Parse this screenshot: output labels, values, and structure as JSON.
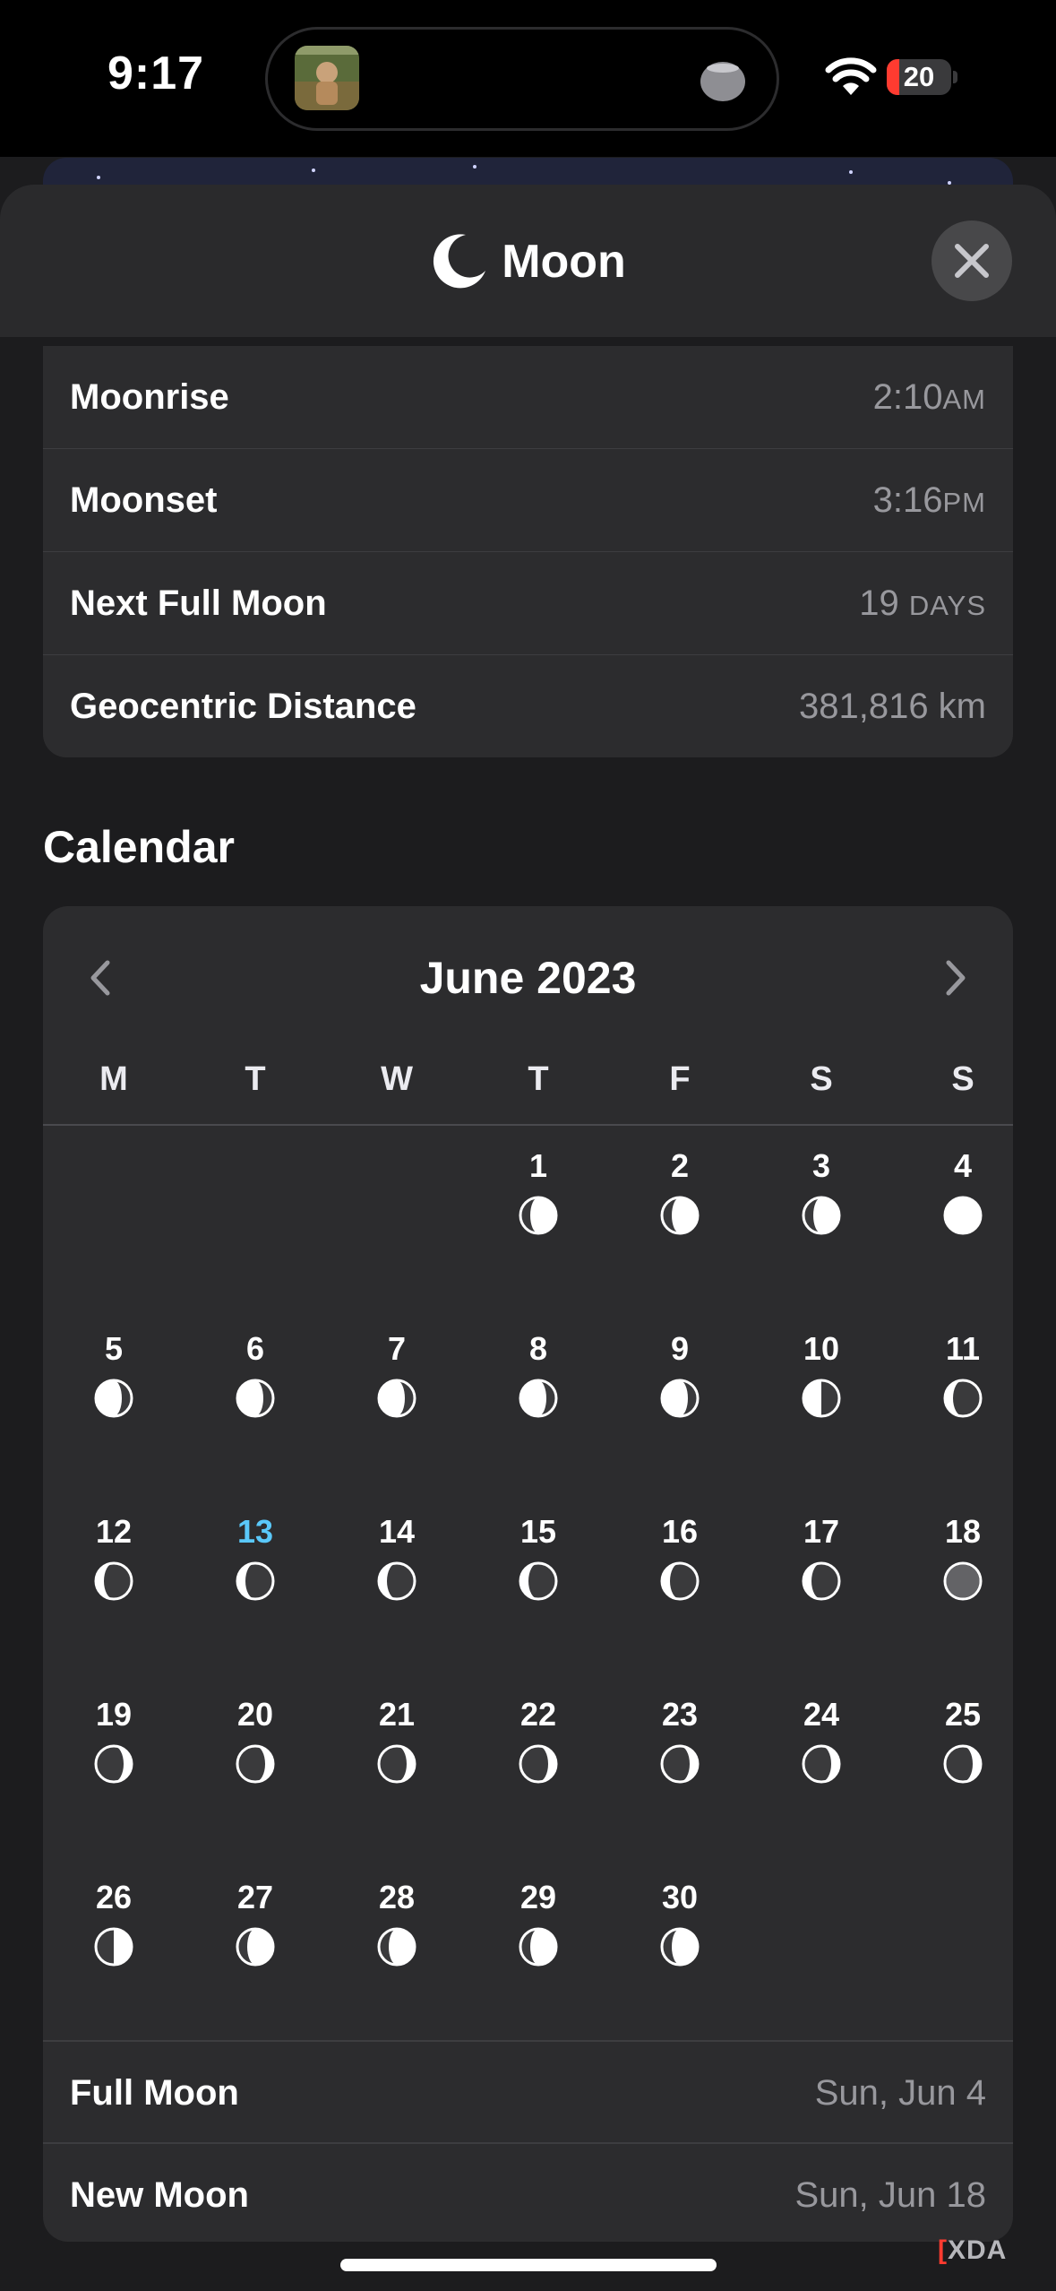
{
  "status_bar": {
    "time": "9:17",
    "battery": "20",
    "battery_level": 0.2,
    "battery_color": "#ff3b30"
  },
  "sheet": {
    "title": "Moon",
    "title_icon": "crescent-moon-icon",
    "close_icon": "close-icon"
  },
  "info_rows": [
    {
      "label": "Moonrise",
      "value": "2:10",
      "suffix": "AM"
    },
    {
      "label": "Moonset",
      "value": "3:16",
      "suffix": "PM"
    },
    {
      "label": "Next Full Moon",
      "value": "19",
      "suffix": "DAYS"
    },
    {
      "label": "Geocentric Distance",
      "value": "381,816 km",
      "suffix": ""
    }
  ],
  "calendar": {
    "section_title": "Calendar",
    "month_label": "June 2023",
    "weekdays": [
      "M",
      "T",
      "W",
      "T",
      "F",
      "S",
      "S"
    ],
    "first_weekday_index": 3,
    "today": 13,
    "today_color": "#5ac8fa",
    "days": [
      {
        "d": "1",
        "phase": "waxing-gibbous"
      },
      {
        "d": "2",
        "phase": "waxing-gibbous"
      },
      {
        "d": "3",
        "phase": "waxing-gibbous"
      },
      {
        "d": "4",
        "phase": "full"
      },
      {
        "d": "5",
        "phase": "waning-gibbous"
      },
      {
        "d": "6",
        "phase": "waning-gibbous"
      },
      {
        "d": "7",
        "phase": "waning-gibbous"
      },
      {
        "d": "8",
        "phase": "waning-gibbous"
      },
      {
        "d": "9",
        "phase": "waning-gibbous"
      },
      {
        "d": "10",
        "phase": "last-quarter"
      },
      {
        "d": "11",
        "phase": "waning-crescent"
      },
      {
        "d": "12",
        "phase": "waning-crescent"
      },
      {
        "d": "13",
        "phase": "waning-crescent"
      },
      {
        "d": "14",
        "phase": "waning-crescent"
      },
      {
        "d": "15",
        "phase": "waning-crescent"
      },
      {
        "d": "16",
        "phase": "waning-crescent"
      },
      {
        "d": "17",
        "phase": "waning-crescent"
      },
      {
        "d": "18",
        "phase": "new"
      },
      {
        "d": "19",
        "phase": "waxing-crescent"
      },
      {
        "d": "20",
        "phase": "waxing-crescent"
      },
      {
        "d": "21",
        "phase": "waxing-crescent"
      },
      {
        "d": "22",
        "phase": "waxing-crescent"
      },
      {
        "d": "23",
        "phase": "waxing-crescent"
      },
      {
        "d": "24",
        "phase": "waxing-crescent"
      },
      {
        "d": "25",
        "phase": "waxing-crescent"
      },
      {
        "d": "26",
        "phase": "first-quarter"
      },
      {
        "d": "27",
        "phase": "waxing-gibbous"
      },
      {
        "d": "28",
        "phase": "waxing-gibbous"
      },
      {
        "d": "29",
        "phase": "waxing-gibbous"
      },
      {
        "d": "30",
        "phase": "waxing-gibbous"
      }
    ],
    "summary": [
      {
        "label": "Full Moon",
        "value": "Sun, Jun 4"
      },
      {
        "label": "New Moon",
        "value": "Sun, Jun 18"
      }
    ]
  },
  "watermark": {
    "bracket": "[",
    "text": "XDA"
  }
}
